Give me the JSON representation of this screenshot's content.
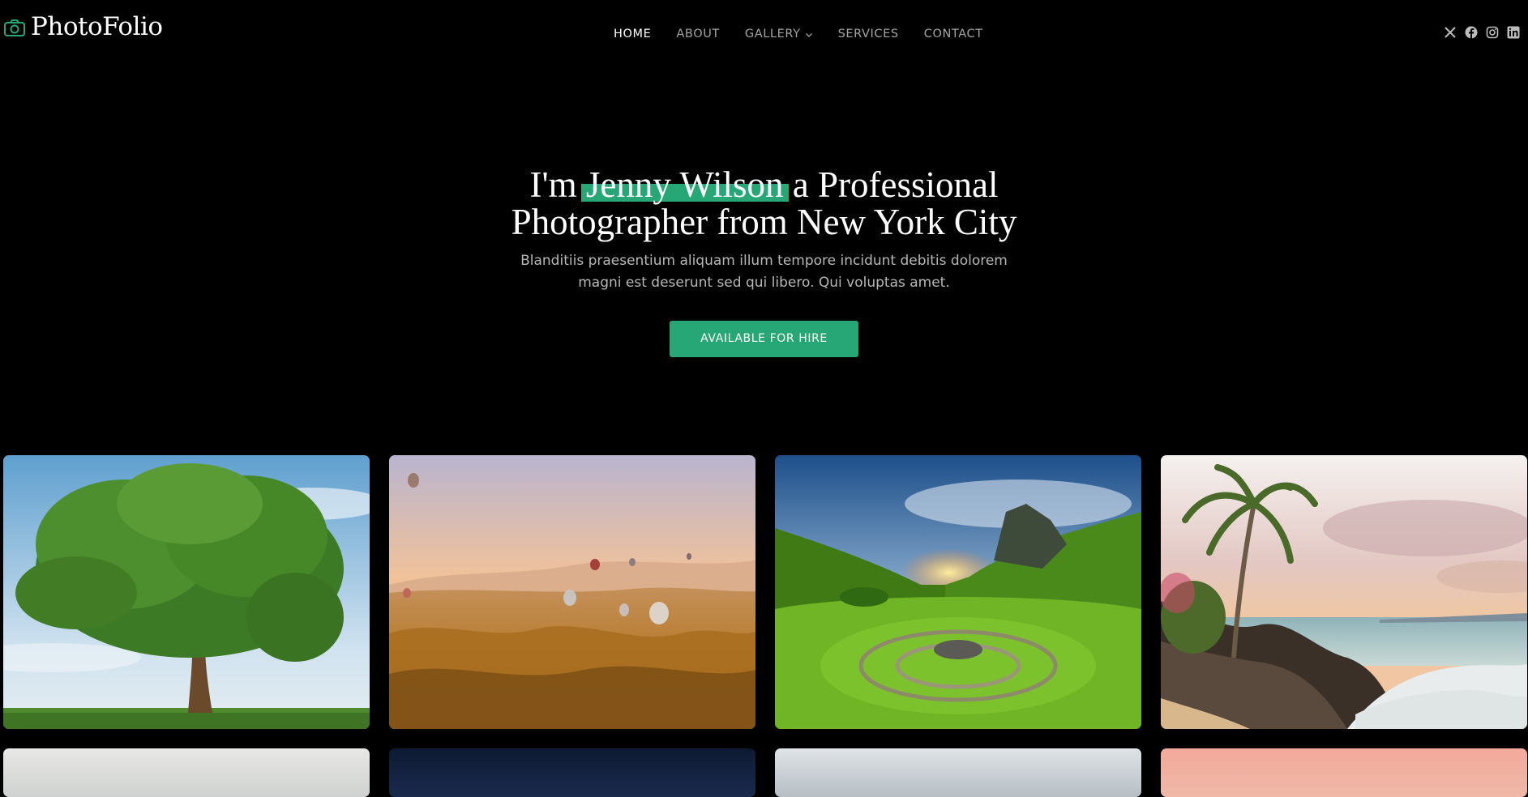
{
  "brand": {
    "name": "PhotoFolio",
    "icon": "camera-icon",
    "accent_color": "#27a776"
  },
  "nav": {
    "items": [
      {
        "label": "HOME",
        "active": true
      },
      {
        "label": "ABOUT",
        "active": false
      },
      {
        "label": "GALLERY",
        "active": false,
        "has_dropdown": true
      },
      {
        "label": "SERVICES",
        "active": false
      },
      {
        "label": "CONTACT",
        "active": false
      }
    ]
  },
  "socials": [
    {
      "icon": "x-twitter-icon"
    },
    {
      "icon": "facebook-icon"
    },
    {
      "icon": "instagram-icon"
    },
    {
      "icon": "linkedin-icon"
    }
  ],
  "hero": {
    "title_prefix": "I'm",
    "title_name": "Jenny Wilson",
    "title_suffix": "a Professional Photographer from New York City",
    "subtitle": "Blanditiis praesentium aliquam illum tempore incidunt debitis dolorem magni est deserunt sed qui libero. Qui voluptas amet.",
    "cta_label": "AVAILABLE FOR HIRE"
  },
  "gallery": {
    "row1": [
      {
        "subject": "tree"
      },
      {
        "subject": "hot-air-balloons"
      },
      {
        "subject": "green-valley-sunset"
      },
      {
        "subject": "palm-beach"
      }
    ]
  },
  "colors": {
    "background": "#000000",
    "nav_inactive": "#a3a3a3",
    "nav_active": "#ffffff"
  }
}
